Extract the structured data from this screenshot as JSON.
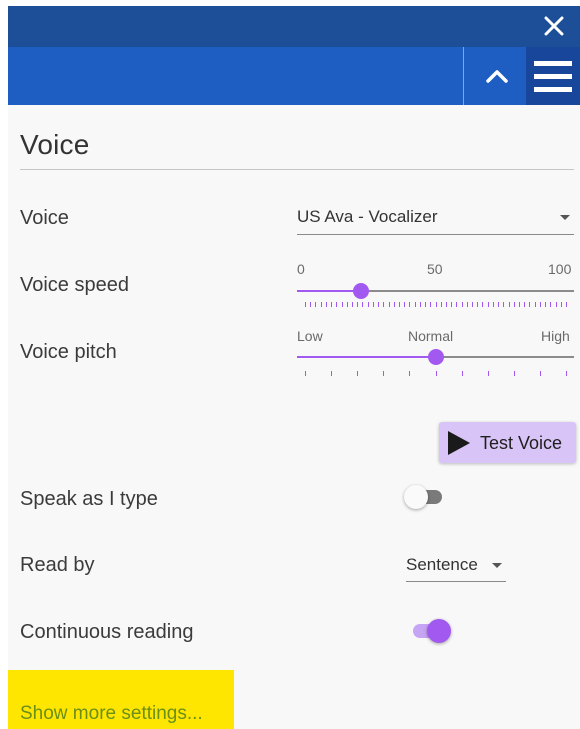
{
  "window": {
    "close_icon": "close-icon"
  },
  "toolbar": {
    "collapse_icon": "chevron-up-icon",
    "menu_icon": "hamburger-menu-icon"
  },
  "section": {
    "title": "Voice"
  },
  "voice": {
    "label": "Voice",
    "selected": "US Ava - Vocalizer"
  },
  "voice_speed": {
    "label": "Voice speed",
    "min_label": "0",
    "mid_label": "50",
    "max_label": "100",
    "value": 23,
    "min": 0,
    "max": 100
  },
  "voice_pitch": {
    "label": "Voice pitch",
    "low_label": "Low",
    "normal_label": "Normal",
    "high_label": "High",
    "value": 0.5
  },
  "test_voice": {
    "label": "Test Voice",
    "icon": "play-icon"
  },
  "speak_as_i_type": {
    "label": "Speak as I type",
    "on": false
  },
  "read_by": {
    "label": "Read by",
    "selected": "Sentence"
  },
  "continuous_reading": {
    "label": "Continuous reading",
    "on": true
  },
  "more": {
    "label": "Show more settings..."
  },
  "colors": {
    "header_dark": "#1c4f98",
    "header": "#1e5dc1",
    "accent": "#a259f0",
    "highlight": "#ffe600",
    "link": "#6b8f19"
  }
}
